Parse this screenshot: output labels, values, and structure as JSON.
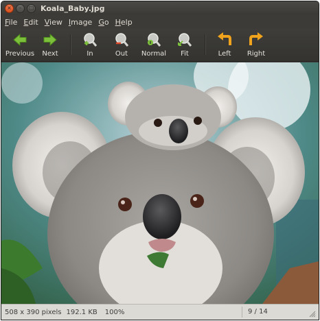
{
  "window": {
    "title": "Koala_Baby.jpg",
    "buttons": {
      "close": "×",
      "minimize": "–",
      "maximize": "□"
    }
  },
  "menu": [
    {
      "id": "file",
      "label": "File",
      "mnemonic": "F",
      "rest": "ile"
    },
    {
      "id": "edit",
      "label": "Edit",
      "mnemonic": "E",
      "rest": "dit"
    },
    {
      "id": "view",
      "label": "View",
      "mnemonic": "V",
      "rest": "iew"
    },
    {
      "id": "image",
      "label": "Image",
      "mnemonic": "I",
      "rest": "mage"
    },
    {
      "id": "go",
      "label": "Go",
      "mnemonic": "G",
      "rest": "o"
    },
    {
      "id": "help",
      "label": "Help",
      "mnemonic": "H",
      "rest": "elp"
    }
  ],
  "toolbar": {
    "previous": {
      "label": "Previous",
      "icon": "arrow-left-icon"
    },
    "next": {
      "label": "Next",
      "icon": "arrow-right-icon"
    },
    "zoom_in": {
      "label": "In",
      "icon": "zoom-in-icon"
    },
    "zoom_out": {
      "label": "Out",
      "icon": "zoom-out-icon"
    },
    "zoom_normal": {
      "label": "Normal",
      "icon": "zoom-normal-icon"
    },
    "zoom_fit": {
      "label": "Fit",
      "icon": "zoom-fit-icon"
    },
    "rotate_left": {
      "label": "Left",
      "icon": "rotate-left-icon"
    },
    "rotate_right": {
      "label": "Right",
      "icon": "rotate-right-icon"
    }
  },
  "status": {
    "dimensions": "508 x 390 pixels",
    "file_size": "192.1 KB",
    "zoom": "100%",
    "position": "9 / 14"
  },
  "colors": {
    "toolbar_bg": "#3c3b37",
    "arrow_green": "#7cbf3a",
    "rotate_orange": "#f0a31c",
    "statusbar_bg": "#dcdad5"
  }
}
